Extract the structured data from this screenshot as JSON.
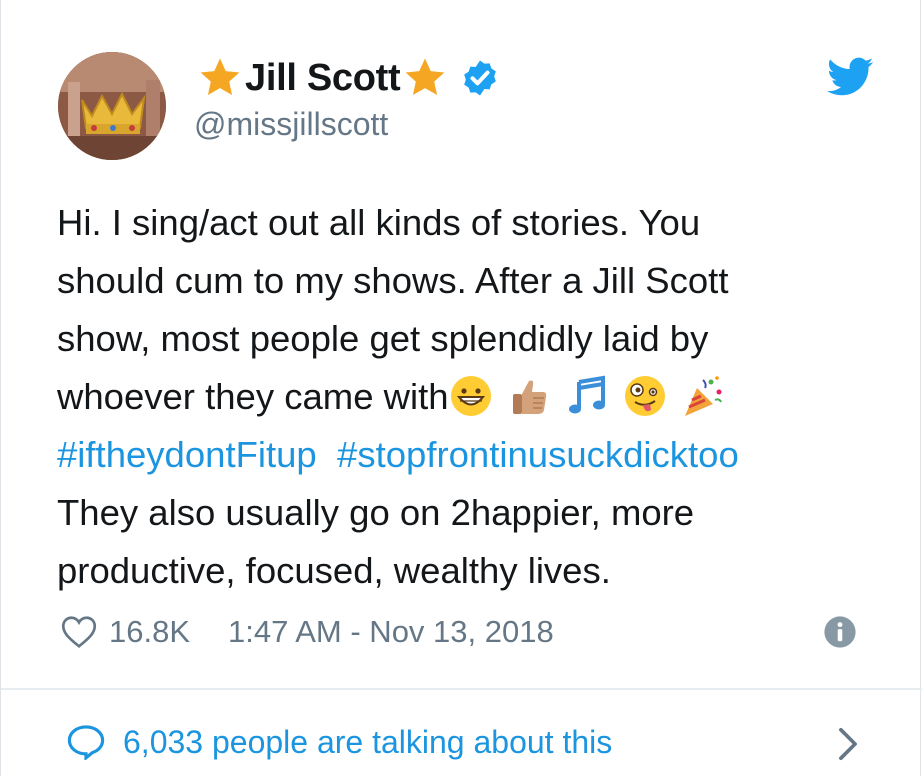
{
  "user": {
    "display_name": "Jill Scott",
    "handle": "@missjillscott",
    "verified": true,
    "avatar": "crown-avatar"
  },
  "tweet": {
    "lines": [
      "Hi. I sing/act out all kinds of stories. You",
      "should cum to my shows. After a Jill Scott",
      "show, most people get splendidly laid by",
      "whoever they came with"
    ],
    "emojis": [
      "grinning-face",
      "thumbs-up",
      "musical-notes",
      "zany-face",
      "party-popper"
    ],
    "hashtags": [
      "#iftheydontFitup",
      "#stopfrontinusuckdicktoo"
    ],
    "after_lines": [
      "They also usually go on 2happier, more",
      "productive, focused, wealthy lives."
    ]
  },
  "meta": {
    "likes": "16.8K",
    "timestamp": "1:47 AM - Nov 13, 2018"
  },
  "footer": {
    "talking": "6,033 people are talking about this"
  },
  "colors": {
    "link": "#1b95e0",
    "secondary": "#657786",
    "star": "#f5a623",
    "twitter_blue": "#1da1f2"
  }
}
